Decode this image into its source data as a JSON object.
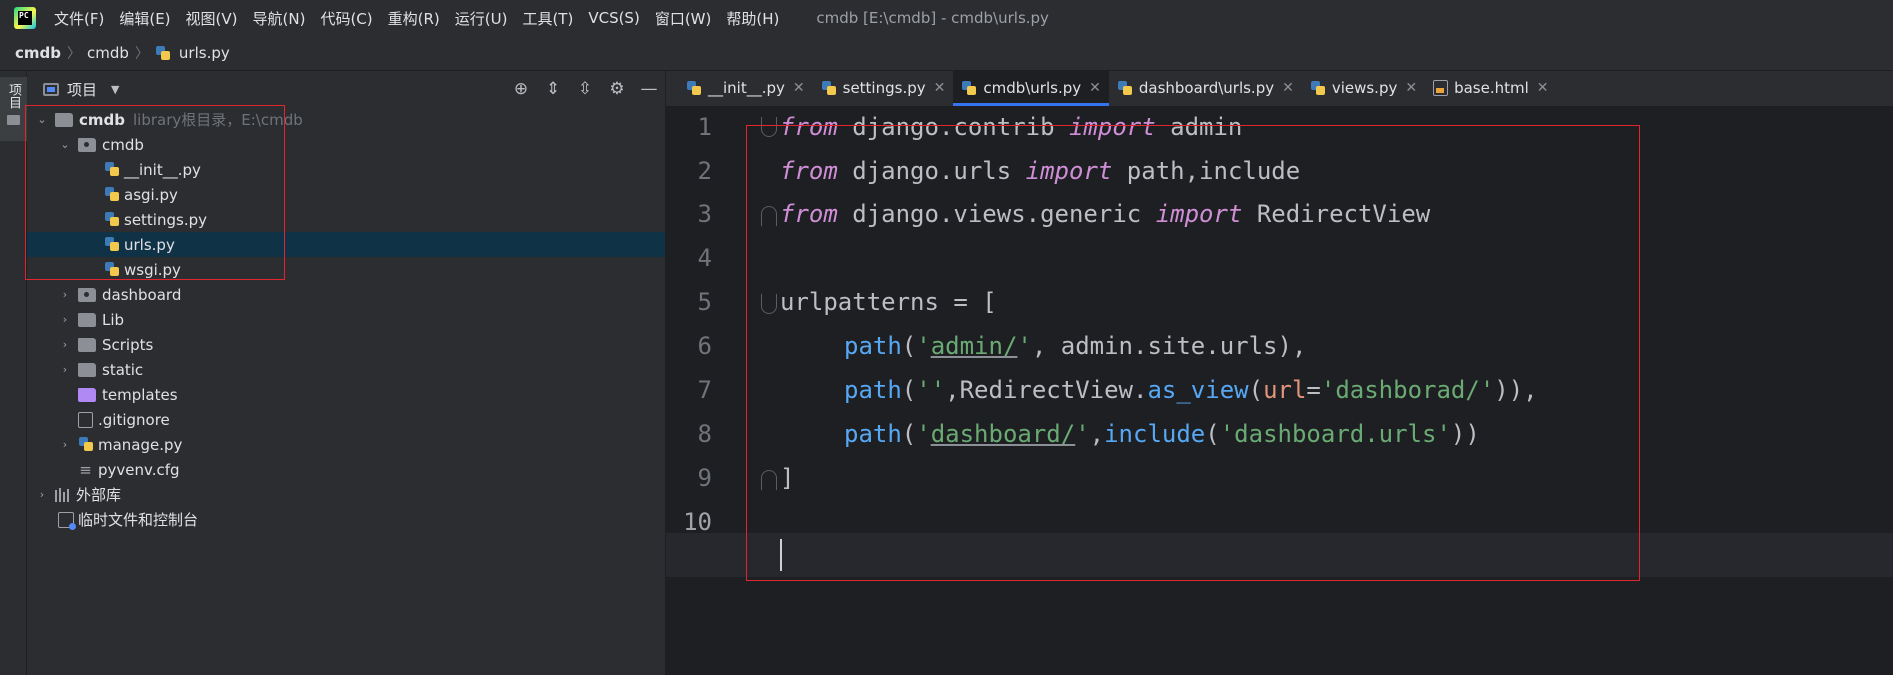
{
  "window": {
    "logo_text": "PC",
    "title": "cmdb [E:\\cmdb] - cmdb\\urls.py",
    "menu": [
      "文件(F)",
      "编辑(E)",
      "视图(V)",
      "导航(N)",
      "代码(C)",
      "重构(R)",
      "运行(U)",
      "工具(T)",
      "VCS(S)",
      "窗口(W)",
      "帮助(H)"
    ]
  },
  "breadcrumb": [
    "cmdb",
    "cmdb",
    "urls.py"
  ],
  "toolstrip": {
    "project_tab": "项目"
  },
  "project": {
    "title": "项目",
    "tree": [
      {
        "label": "cmdb",
        "hint": "library根目录，E:\\cmdb"
      },
      {
        "label": "cmdb"
      },
      {
        "label": "__init__.py"
      },
      {
        "label": "asgi.py"
      },
      {
        "label": "settings.py"
      },
      {
        "label": "urls.py"
      },
      {
        "label": "wsgi.py"
      },
      {
        "label": "dashboard"
      },
      {
        "label": "Lib"
      },
      {
        "label": "Scripts"
      },
      {
        "label": "static"
      },
      {
        "label": "templates"
      },
      {
        "label": ".gitignore"
      },
      {
        "label": "manage.py"
      },
      {
        "label": "pyvenv.cfg"
      },
      {
        "label": "外部库"
      },
      {
        "label": "临时文件和控制台"
      }
    ]
  },
  "tabs": [
    {
      "label": "__init__.py"
    },
    {
      "label": "settings.py"
    },
    {
      "label": "cmdb\\urls.py"
    },
    {
      "label": "dashboard\\urls.py"
    },
    {
      "label": "views.py"
    },
    {
      "label": "base.html"
    }
  ],
  "editor": {
    "line_numbers": [
      "1",
      "2",
      "3",
      "4",
      "5",
      "6",
      "7",
      "8",
      "9",
      "10"
    ],
    "code": {
      "l1": {
        "a": "from",
        "b": " django.contrib ",
        "c": "import",
        "d": " admin"
      },
      "l2": {
        "a": "from",
        "b": " django.urls ",
        "c": "import",
        "d": " path,include"
      },
      "l3": {
        "a": "from",
        "b": " django.views.generic ",
        "c": "import",
        "d": " RedirectView"
      },
      "l5": {
        "a": "urlpatterns = ["
      },
      "l6": {
        "a": "path",
        "b": "(",
        "c": "'",
        "d": "admin/",
        "e": "'",
        "f": ", admin.site.urls),"
      },
      "l7": {
        "a": "path",
        "b": "(",
        "c": "''",
        "d": ",RedirectView.",
        "e": "as_view",
        "f": "(",
        "g": "url",
        "h": "=",
        "i": "'dashborad/'",
        "j": ")),"
      },
      "l8": {
        "a": "path",
        "b": "(",
        "c": "'",
        "d": "dashboard/",
        "e": "'",
        "f": ",",
        "g": "include",
        "h": "(",
        "i": "'dashboard.urls'",
        "j": "))"
      },
      "l9": {
        "a": "]"
      }
    }
  }
}
